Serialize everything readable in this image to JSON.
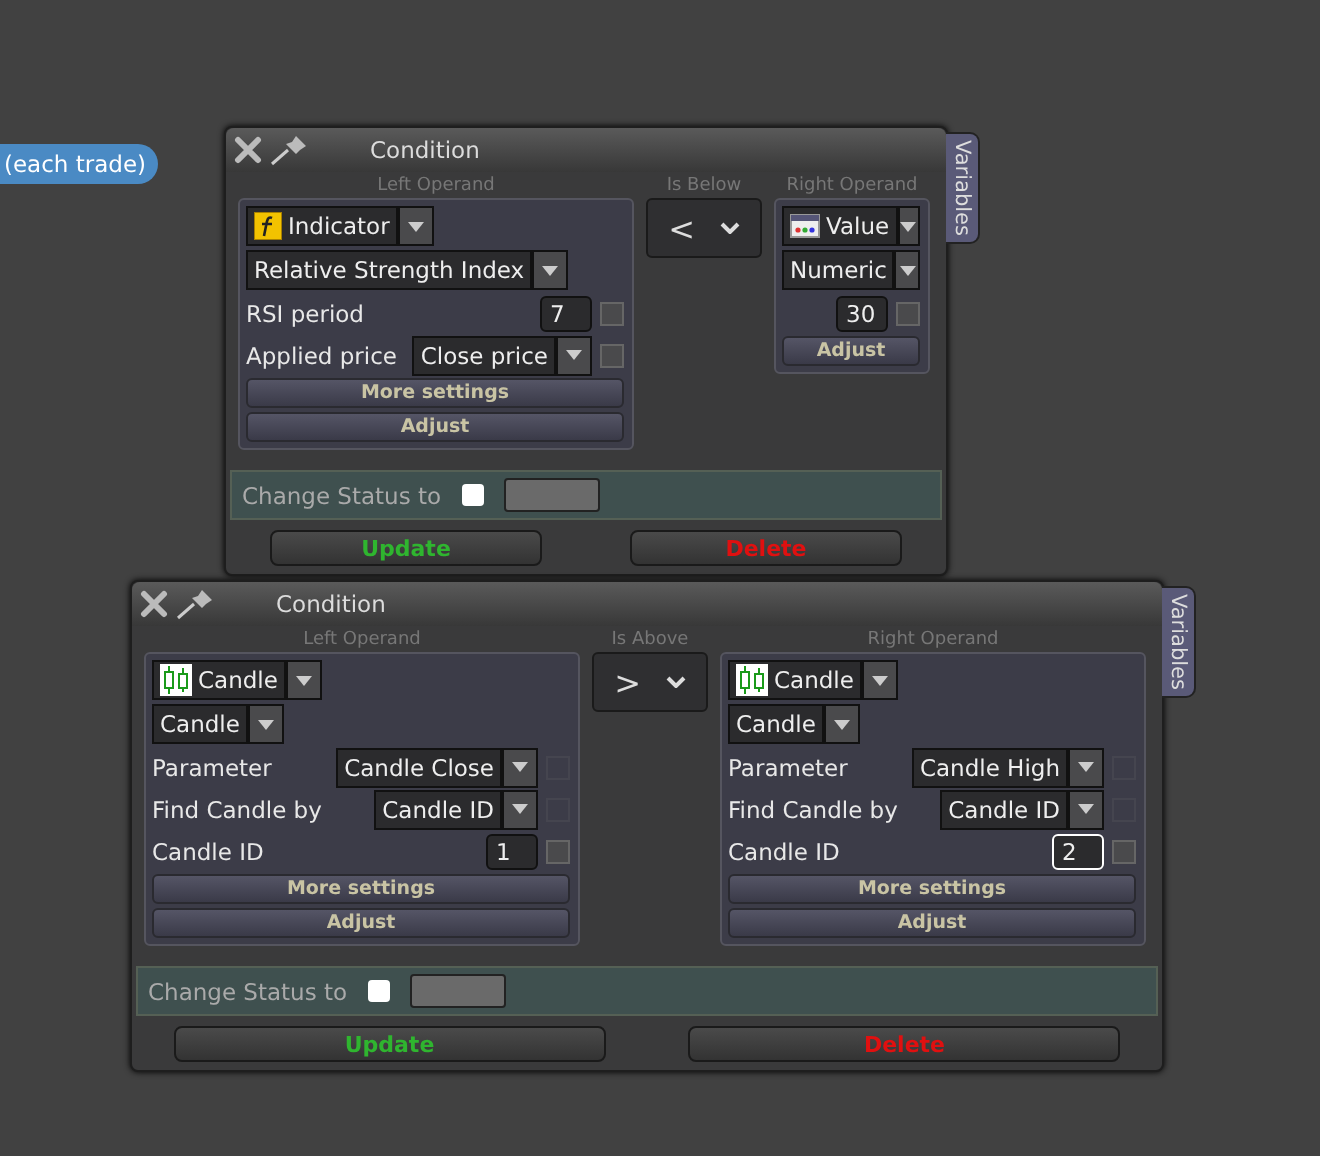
{
  "tag": {
    "label": "(each trade)"
  },
  "windows": [
    {
      "title": "Condition",
      "side_tab": "Variables",
      "left": {
        "heading": "Left Operand",
        "source": {
          "kind": "indicator",
          "label": "Indicator"
        },
        "subtype": "Relative Strength Index",
        "params": [
          {
            "kind": "number",
            "label": "RSI period",
            "value": "7",
            "focused": false,
            "checked": false,
            "disabled": false
          },
          {
            "kind": "select",
            "label": "Applied price",
            "value": "Close price",
            "checked": false,
            "disabled": false
          }
        ],
        "buttons": [
          "More settings",
          "Adjust"
        ]
      },
      "operator": {
        "heading": "Is Below",
        "symbol": "<"
      },
      "right": {
        "heading": "Right Operand",
        "source": {
          "kind": "value",
          "label": "Value"
        },
        "subtype": "Numeric",
        "params": [
          {
            "kind": "number",
            "value": "30",
            "focused": false,
            "checked": false,
            "disabled": false
          }
        ],
        "buttons": [
          "Adjust"
        ]
      },
      "status": {
        "label": "Change Status to",
        "checked": false
      },
      "actions": [
        {
          "kind": "update",
          "label": "Update"
        },
        {
          "kind": "delete",
          "label": "Delete"
        }
      ]
    },
    {
      "title": "Condition",
      "side_tab": "Variables",
      "left": {
        "heading": "Left Operand",
        "source": {
          "kind": "candle",
          "label": "Candle"
        },
        "subtype": "Candle",
        "params": [
          {
            "kind": "select",
            "label": "Parameter",
            "value": "Candle Close",
            "checked": false,
            "disabled": true
          },
          {
            "kind": "select",
            "label": "Find Candle by",
            "value": "Candle ID",
            "checked": false,
            "disabled": true
          },
          {
            "kind": "number",
            "label": "Candle ID",
            "value": "1",
            "focused": false,
            "checked": false,
            "disabled": false
          }
        ],
        "buttons": [
          "More settings",
          "Adjust"
        ]
      },
      "operator": {
        "heading": "Is Above",
        "symbol": ">"
      },
      "right": {
        "heading": "Right Operand",
        "source": {
          "kind": "candle",
          "label": "Candle"
        },
        "subtype": "Candle",
        "params": [
          {
            "kind": "select",
            "label": "Parameter",
            "value": "Candle High",
            "checked": false,
            "disabled": true
          },
          {
            "kind": "select",
            "label": "Find Candle by",
            "value": "Candle ID",
            "checked": false,
            "disabled": true
          },
          {
            "kind": "number",
            "label": "Candle ID",
            "value": "2",
            "focused": true,
            "checked": false,
            "disabled": false
          }
        ],
        "buttons": [
          "More settings",
          "Adjust"
        ]
      },
      "status": {
        "label": "Change Status to",
        "checked": false
      },
      "actions": [
        {
          "kind": "update",
          "label": "Update"
        },
        {
          "kind": "delete",
          "label": "Delete"
        }
      ]
    }
  ]
}
